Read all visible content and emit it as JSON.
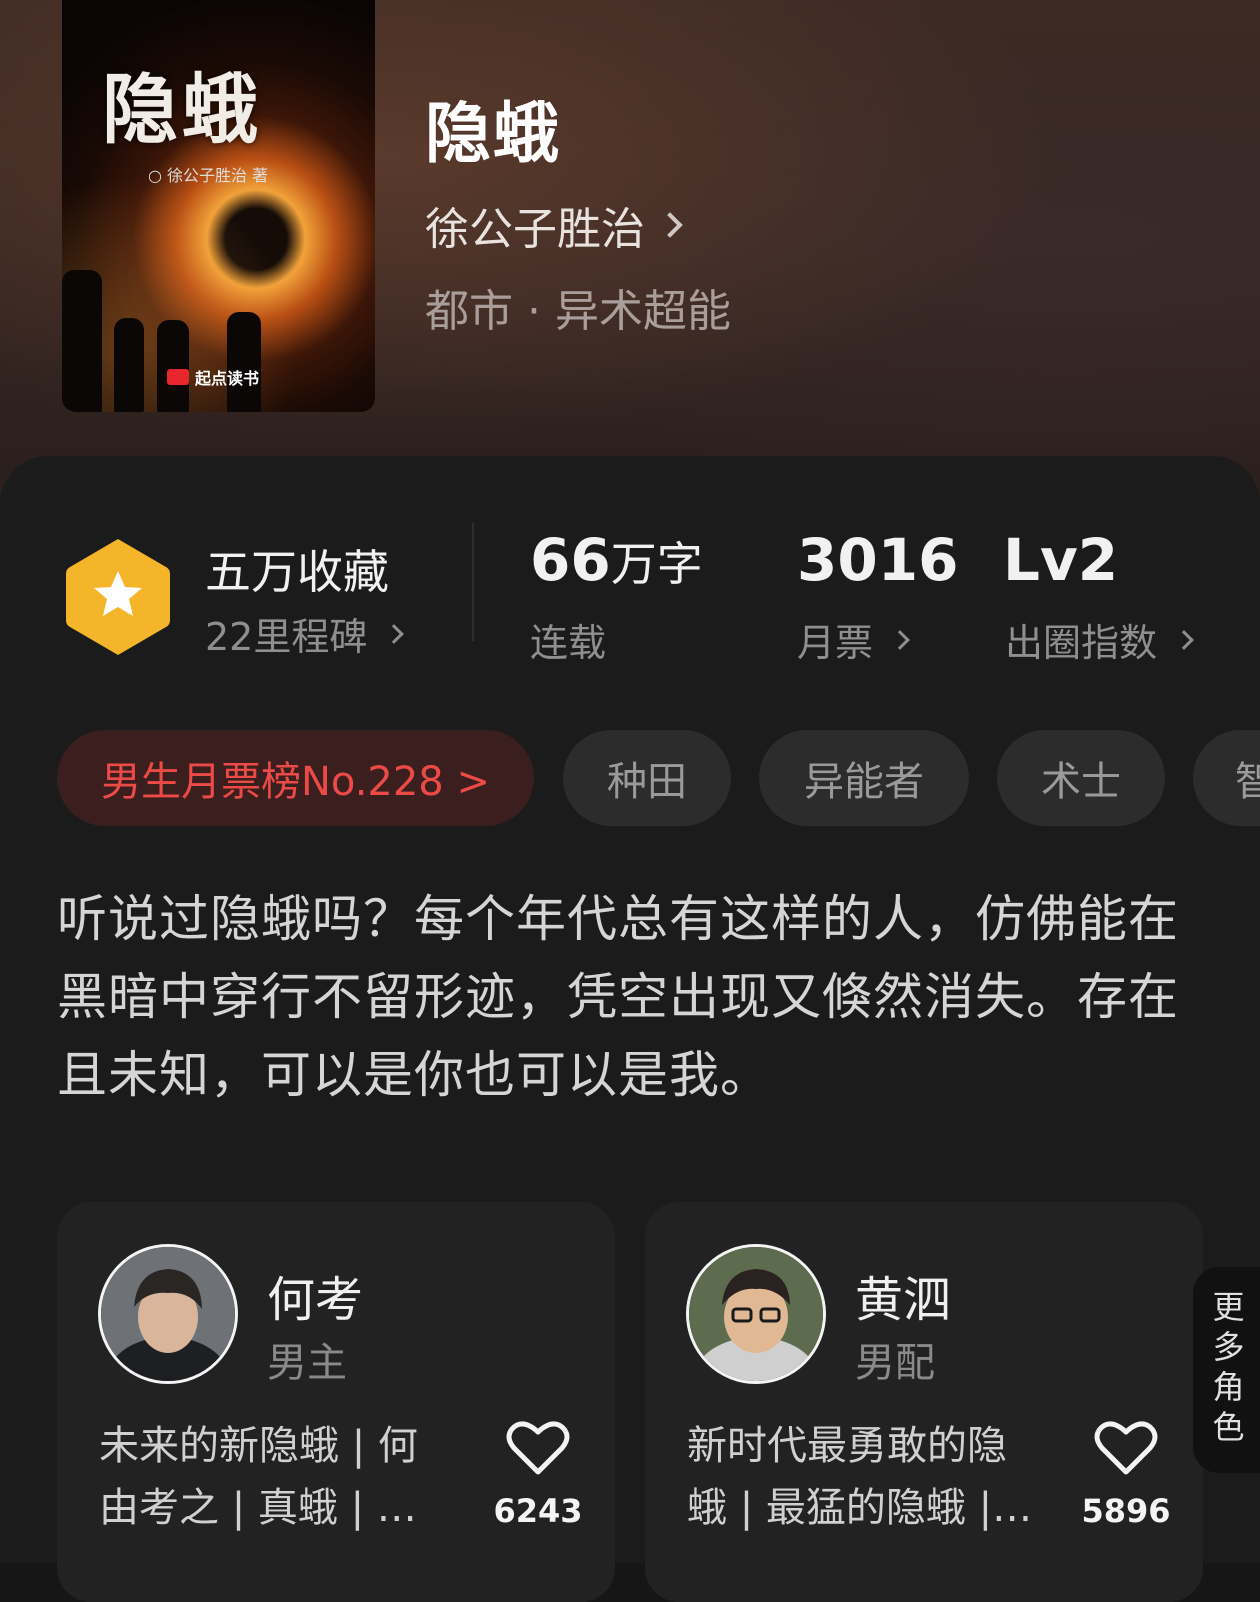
{
  "book": {
    "title": "隐蛾",
    "author": "徐公子胜治",
    "genre": "都市 · 异术超能",
    "cover": {
      "title": "隐蛾",
      "author_line": "○ 徐公子胜治 著",
      "publisher": "起点读书"
    }
  },
  "stats": {
    "collection": {
      "main": "五万收藏",
      "sub": "22里程碑"
    },
    "words": {
      "number": "66",
      "unit": "万字",
      "sub": "连载"
    },
    "monthly_votes": {
      "number": "3016",
      "sub": "月票"
    },
    "influence": {
      "number": "Lv2",
      "sub": "出圈指数"
    },
    "badge_color": "#F5B52A"
  },
  "tags": {
    "rank": "男生月票榜No.228 >",
    "items": [
      "种田",
      "异能者",
      "术士",
      "智"
    ]
  },
  "description": "听说过隐蛾吗？每个年代总有这样的人，仿佛能在黑暗中穿行不留形迹，凭空出现又倏然消失。存在且未知，可以是你也可以是我。",
  "characters": [
    {
      "name": "何考",
      "role": "男主",
      "desc": "未来的新隐蛾 | 何由考之 | 真蛾 | …",
      "likes": "6243"
    },
    {
      "name": "黄泗",
      "role": "男配",
      "desc": "新时代最勇敢的隐蛾 | 最猛的隐蛾 |…",
      "likes": "5896"
    }
  ],
  "more_roles": "更多角色"
}
